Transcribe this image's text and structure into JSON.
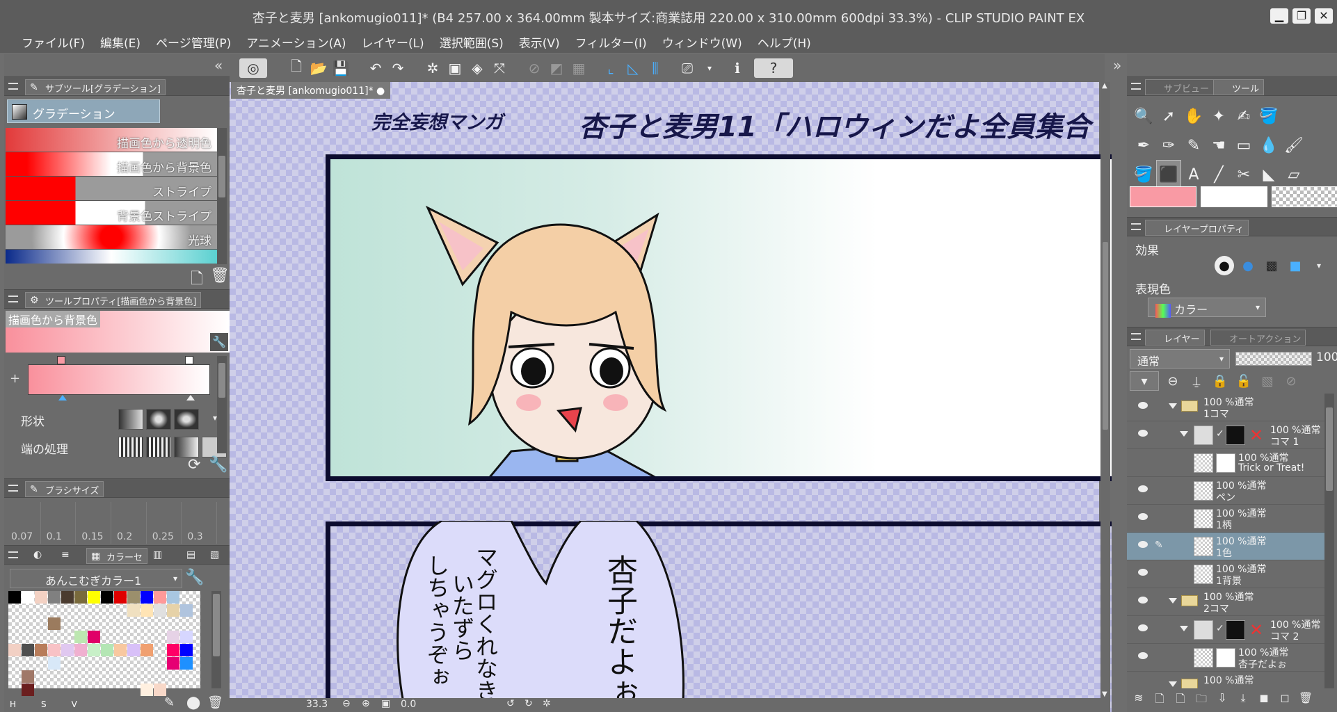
{
  "window": {
    "title": "杏子と麦男 [ankomugio011]* (B4 257.00 x 364.00mm 製本サイズ:商業誌用 220.00 x 310.00mm 600dpi 33.3%)  - CLIP STUDIO PAINT EX"
  },
  "menu": [
    "ファイル(F)",
    "編集(E)",
    "ページ管理(P)",
    "アニメーション(A)",
    "レイヤー(L)",
    "選択範囲(S)",
    "表示(V)",
    "フィルター(I)",
    "ウィンドウ(W)",
    "ヘルプ(H)"
  ],
  "subtool": {
    "tab": "サブツール[グラデーション]",
    "group_name": "グラデーション",
    "items": [
      "描画色から透明色",
      "描画色から背景色",
      "ストライプ",
      "背景色ストライプ",
      "光球"
    ]
  },
  "tool_property": {
    "tab": "ツールプロパティ[描画色から背景色]",
    "preview_label": "描画色から背景色",
    "shape_label": "形状",
    "edge_label": "端の処理"
  },
  "brush_size": {
    "tab": "ブラシサイズ",
    "sizes": [
      "0.07",
      "0.1",
      "0.15",
      "0.2",
      "0.25",
      "0.3"
    ]
  },
  "color_set": {
    "tab": "カラーセ",
    "name": "あんこむぎカラー1",
    "hsv": [
      "H",
      "S",
      "V"
    ],
    "swatches": [
      "#000000",
      "#ffffff",
      "#f3d1c3",
      "#808080",
      "#4a3b2f",
      "#796a3c",
      "#ffff00",
      "#000000",
      "#e00000",
      "#9b8f6c",
      "#0000ff",
      "#ff9999",
      "#a8c6e0",
      "",
      "",
      "",
      "",
      "",
      "",
      "",
      "",
      "",
      "",
      "",
      "#f0e0c0",
      "#ffe4b5",
      "#e0e0e0",
      "#e6d2a8",
      "#b0c4de",
      "",
      "",
      "",
      "",
      "#9b7b5e",
      "",
      "",
      "",
      "",
      "",
      "",
      "",
      "",
      "",
      "",
      "",
      "",
      "",
      "",
      "",
      "",
      "#bde7b1",
      "#e00068",
      "",
      "",
      "",
      "",
      "",
      "#e6d2e6",
      "#d6d6ff",
      "",
      "#f2d0c4",
      "#4f4f4f",
      "#b87c5a",
      "#f8c2c6",
      "#e0c8f0",
      "#f0b0d0",
      "#c8f0c8",
      "#b4e6b4",
      "#f8c8a0",
      "#d8c0f8",
      "#f0a070",
      "",
      "#ff0066",
      "#0000ff",
      "",
      "",
      "",
      "",
      "#d8e8f8",
      "",
      "",
      "",
      "",
      "",
      "",
      "",
      "",
      "#e60073",
      "#1e90ff",
      "",
      "",
      "#a07868",
      "",
      "",
      "",
      "",
      "",
      "",
      "",
      "",
      "",
      "",
      "",
      "",
      "",
      "",
      "#6b1e1e",
      "",
      "",
      "",
      "",
      "",
      "",
      "",
      "",
      "#fff0e0",
      "#f8d8c8",
      "",
      "",
      ""
    ]
  },
  "document": {
    "tab": "杏子と麦男 [ankomugio011]*",
    "subtitle": "完全妄想マンガ",
    "headline": "杏子と麦男11「ハロウィンだよ全員集合",
    "bubble_left_1": "マグロくれなき",
    "bubble_left_2": "いたずら",
    "bubble_left_3": "しちゃうぞぉ",
    "bubble_right": "杏子だよぉ"
  },
  "status": {
    "zoom": "33.3",
    "angle": "0.0"
  },
  "right_tabs": {
    "subview": "サブビュー",
    "tool": "ツール",
    "layer_property": "レイヤープロパティ",
    "layer": "レイヤー",
    "auto_action": "オートアクション"
  },
  "tools": [
    "🔍",
    "➚",
    "✋",
    "✦",
    "✍",
    "🪣",
    "✒",
    "✑",
    "✎",
    "☚",
    "▭",
    "💧",
    "🖌",
    "⬛",
    "A",
    "╱",
    "✂",
    "◣",
    "▱"
  ],
  "colors": {
    "main": "#f99aa4",
    "sub": "#ffffff"
  },
  "layer_property": {
    "effect_label": "効果",
    "expression_label": "表現色",
    "expression_value": "カラー"
  },
  "layer_panel": {
    "blend_mode": "通常",
    "opacity": "100",
    "layers": [
      {
        "type": "folder",
        "mode": "100 %通常",
        "name": "1コマ"
      },
      {
        "type": "frame",
        "mode": "100 %通常",
        "name": "コマ 1"
      },
      {
        "type": "text",
        "mode": "100 %通常",
        "name": "Trick or Treat!"
      },
      {
        "type": "raster",
        "mode": "100 %通常",
        "name": "ペン"
      },
      {
        "type": "raster",
        "mode": "100 %通常",
        "name": "1柄"
      },
      {
        "type": "raster",
        "mode": "100 %通常",
        "name": "1色",
        "selected": true
      },
      {
        "type": "raster",
        "mode": "100 %通常",
        "name": "1背景"
      },
      {
        "type": "folder",
        "mode": "100 %通常",
        "name": "2コマ"
      },
      {
        "type": "frame",
        "mode": "100 %通常",
        "name": "コマ 2"
      },
      {
        "type": "text",
        "mode": "100 %通常",
        "name": "杏子だよぉ"
      },
      {
        "type": "folder",
        "mode": "100 %通常",
        "name": ""
      }
    ]
  }
}
